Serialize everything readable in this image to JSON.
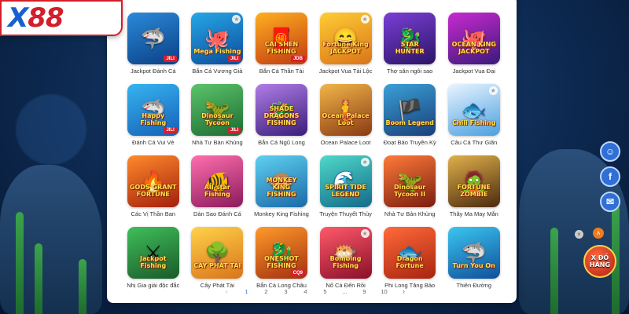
{
  "brand": {
    "logo_x": "X",
    "logo_num": "88"
  },
  "tabs": [
    "",
    "",
    ""
  ],
  "games": [
    {
      "name": "Jackpot Đánh Cá",
      "thumb_text": "",
      "provider": "JILI",
      "glyph": "🦈",
      "bg": [
        "#2b8ad9",
        "#0b3f86"
      ],
      "star": false
    },
    {
      "name": "Bắn Cá Vương Giả",
      "thumb_text": "Mega Fishing",
      "provider": "JILI",
      "glyph": "🐙",
      "bg": [
        "#26a7e6",
        "#0c4c9b"
      ],
      "star": true
    },
    {
      "name": "Bắn Cá Thần Tài",
      "thumb_text": "CAI SHEN FISHING",
      "provider": "JDB",
      "glyph": "🧧",
      "bg": [
        "#ffb020",
        "#c23a12"
      ],
      "star": false
    },
    {
      "name": "Jackpot Vua Tài Lộc",
      "thumb_text": "Fortune King JACKPOT",
      "provider": "",
      "glyph": "😄",
      "bg": [
        "#ffcc33",
        "#d9751a"
      ],
      "star": true
    },
    {
      "name": "Thợ săn ngôi sao",
      "thumb_text": "STAR HUNTER",
      "provider": "",
      "glyph": "🐉",
      "bg": [
        "#7a3fd6",
        "#2b1466"
      ],
      "star": false
    },
    {
      "name": "Jackpot Vua Đại",
      "thumb_text": "OCEAN KING JACKPOT",
      "provider": "",
      "glyph": "🐙",
      "bg": [
        "#c92ad1",
        "#3a1a7a"
      ],
      "star": false
    },
    {
      "name": "Đánh Cá Vui Vẻ",
      "thumb_text": "Happy Fishing",
      "provider": "JILI",
      "glyph": "🦈",
      "bg": [
        "#36b4f0",
        "#1660b8"
      ],
      "star": false
    },
    {
      "name": "Nhà Tư Bản Khủng",
      "thumb_text": "Dinosaur Tycoon",
      "provider": "JILI",
      "glyph": "🦖",
      "bg": [
        "#5bc46a",
        "#1d6b33"
      ],
      "star": false
    },
    {
      "name": "Bắn Cá Ngũ Long",
      "thumb_text": "SHADE DRAGONS FISHING",
      "provider": "",
      "glyph": "🐲",
      "bg": [
        "#b07de6",
        "#3a1e7a"
      ],
      "star": false
    },
    {
      "name": "Ocean Palace Loot",
      "thumb_text": "Ocean Palace Loot",
      "provider": "",
      "glyph": "🧜",
      "bg": [
        "#f1b64a",
        "#8a3a12"
      ],
      "star": false
    },
    {
      "name": "Đoạt Bảo Truyền Kỳ",
      "thumb_text": "Boom Legend",
      "provider": "",
      "glyph": "🏴",
      "bg": [
        "#3aa0d6",
        "#1a3f7a"
      ],
      "star": false
    },
    {
      "name": "Câu Cá Thư Giãn",
      "thumb_text": "Chill Fishing",
      "provider": "",
      "glyph": "🐟",
      "bg": [
        "#e9f4ff",
        "#4aa0e0"
      ],
      "star": true
    },
    {
      "name": "Các Vị Thần Ban",
      "thumb_text": "GODS GRANT FORTUNE",
      "provider": "",
      "glyph": "🔥",
      "bg": [
        "#ff8a2a",
        "#a3200f"
      ],
      "star": false
    },
    {
      "name": "Dàn Sao Đánh Cá",
      "thumb_text": "All-star Fishing",
      "provider": "",
      "glyph": "🐠",
      "bg": [
        "#ff6fae",
        "#8a1a5b"
      ],
      "star": false
    },
    {
      "name": "Monkey King Fishing",
      "thumb_text": "MONKEY KING FISHING",
      "provider": "",
      "glyph": "🐵",
      "bg": [
        "#5fd0f0",
        "#1a6aa8"
      ],
      "star": false
    },
    {
      "name": "Truyện Thuyết Thủy",
      "thumb_text": "SPIRIT TIDE LEGEND",
      "provider": "",
      "glyph": "🌊",
      "bg": [
        "#4fd8c9",
        "#136b8a"
      ],
      "star": true
    },
    {
      "name": "Nhà Tư Bản Khủng",
      "thumb_text": "Dinosaur Tycoon II",
      "provider": "",
      "glyph": "🦖",
      "bg": [
        "#ff7a3a",
        "#7a1e0f"
      ],
      "star": false
    },
    {
      "name": "Thây Ma May Mắn",
      "thumb_text": "FORTUNE ZOMBIE",
      "provider": "",
      "glyph": "🧟",
      "bg": [
        "#e0b04a",
        "#4a2a0f"
      ],
      "star": false
    },
    {
      "name": "Nhị Gia giải độc đắc",
      "thumb_text": "Jackpot Fishing",
      "provider": "",
      "glyph": "⚔",
      "bg": [
        "#3fbf5a",
        "#1a5a2a"
      ],
      "star": false
    },
    {
      "name": "Cây Phát Tài",
      "thumb_text": "CÂY PHÁT TÀI",
      "provider": "",
      "glyph": "🌳",
      "bg": [
        "#ffd24a",
        "#d9741a"
      ],
      "star": false
    },
    {
      "name": "Bắn Cá Long Châu",
      "thumb_text": "ONESHOT FISHING",
      "provider": "CQ9",
      "glyph": "🐉",
      "bg": [
        "#ff9a2a",
        "#a3300f"
      ],
      "star": false
    },
    {
      "name": "Nổ Cá Đến Rồi",
      "thumb_text": "Bombing Fishing",
      "provider": "",
      "glyph": "🐡",
      "bg": [
        "#ff5a6a",
        "#8a0f2a"
      ],
      "star": true
    },
    {
      "name": "Phi Long Tăng Bảo",
      "thumb_text": "Dragon Fortune",
      "provider": "",
      "glyph": "🐟",
      "bg": [
        "#ff6a3a",
        "#a8240f"
      ],
      "star": false
    },
    {
      "name": "Thiên Đường",
      "thumb_text": "Turn You On",
      "provider": "",
      "glyph": "🦈",
      "bg": [
        "#3ac6f0",
        "#0f4f9a"
      ],
      "star": false
    }
  ],
  "pagination": {
    "prev": "‹",
    "pages": [
      "1",
      "2",
      "3",
      "4",
      "5",
      "...",
      "9",
      "10"
    ],
    "current": "1",
    "next": "›"
  },
  "side": {
    "close": "×",
    "up": "˄",
    "gift_label": "X ĐỒ HÀNG"
  }
}
